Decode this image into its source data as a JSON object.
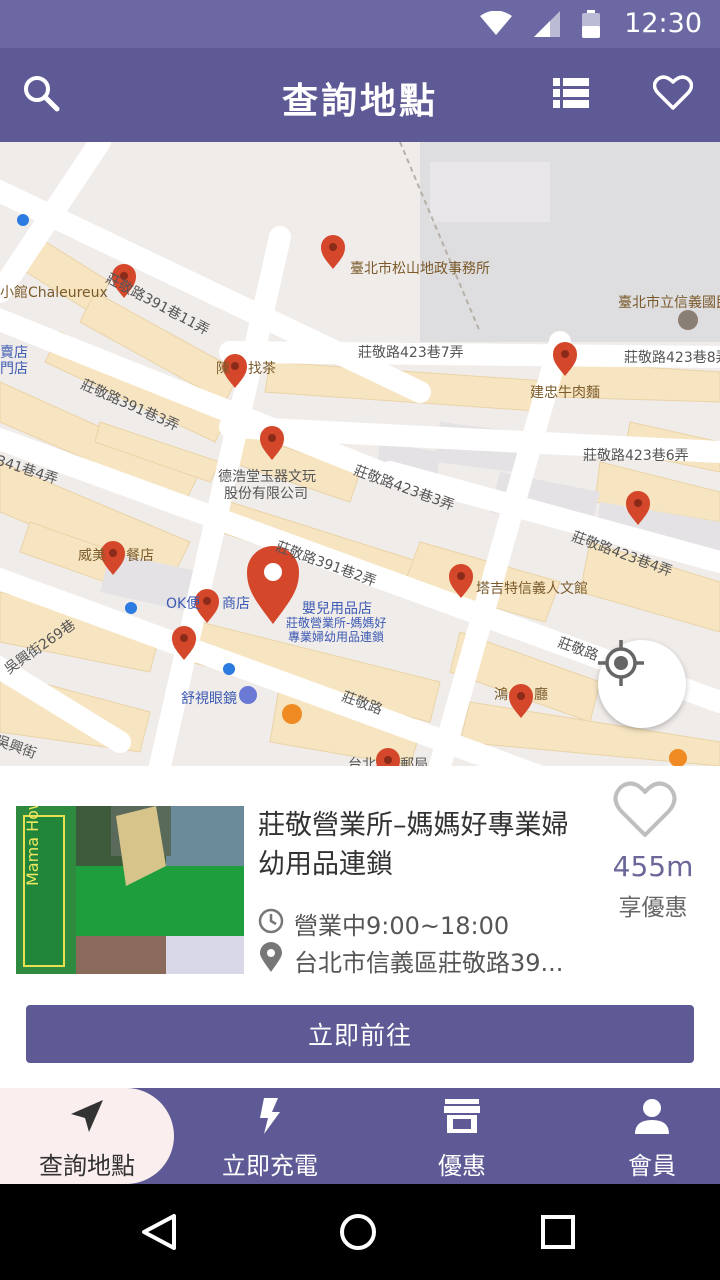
{
  "status_bar": {
    "time": "12:30",
    "icons": [
      "wifi-icon",
      "signal-icon",
      "battery-icon"
    ]
  },
  "app_bar": {
    "title": "查詢地點",
    "actions": [
      "search-icon",
      "list-icon",
      "heart-icon"
    ]
  },
  "map": {
    "road_labels": [
      "莊敬路391巷11弄",
      "莊敬路391巷3弄",
      "莊敬路423巷7弄",
      "莊敬路423巷8弄",
      "莊敬路423巷6弄",
      "莊敬路423巷3弄",
      "莊敬路423巷4弄",
      "莊敬路391巷2弄",
      "莊敬路",
      "吳興街269巷",
      "341巷4弄",
      "莊敬路",
      "吳興街"
    ],
    "poi_labels": [
      "臺北市松山地政事務所",
      "臺北市立信義國民",
      "小館Chaleureux",
      "賣店",
      "門店",
      "陳",
      "找茶",
      "建忠牛肉麵",
      "德浩堂玉器文玩",
      "股份有限公司",
      "威美",
      "餐店",
      "OK便",
      "商店",
      "嬰兒用品店",
      "莊敬營業所-媽媽好",
      "專業婦幼用品連鎖",
      "塔吉特信義人文館",
      "舒視眼鏡",
      "鴻",
      "廳",
      "台北",
      "郵局"
    ],
    "locate_button": "crosshair-icon"
  },
  "store_card": {
    "name": "莊敬營業所–媽媽好專業婦幼用品連鎖",
    "hours": "營業中9:00~18:00",
    "address": "台北市信義區莊敬路39...",
    "distance": "455m",
    "discount_label": "享優惠",
    "go_button": "立即前往",
    "photo_sign_text": "Mama How!"
  },
  "bottom_nav": {
    "items": [
      {
        "label": "查詢地點",
        "icon": "navigation-arrow-icon",
        "active": true
      },
      {
        "label": "立即充電",
        "icon": "lightning-icon",
        "active": false
      },
      {
        "label": "優惠",
        "icon": "store-icon",
        "active": false
      },
      {
        "label": "會員",
        "icon": "person-icon",
        "active": false
      }
    ]
  },
  "colors": {
    "primary": "#5e5a96",
    "status_bar": "#6b68a3",
    "marker": "#d4472b",
    "distance_text": "#6b6799",
    "active_tab_bg": "#fbeeee"
  }
}
